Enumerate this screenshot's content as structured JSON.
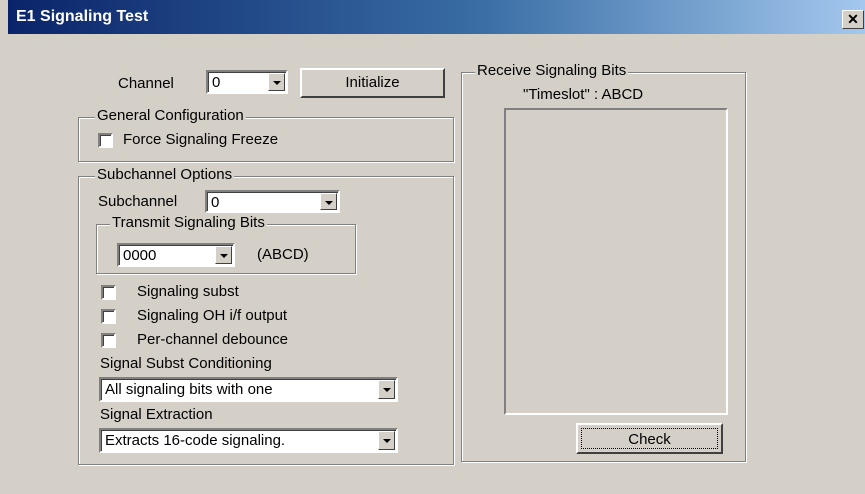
{
  "window": {
    "title": "E1 Signaling Test",
    "close_glyph": "✕"
  },
  "channel": {
    "label": "Channel",
    "value": "0",
    "initialize_label": "Initialize"
  },
  "general": {
    "title": "General Configuration",
    "force_freeze_label": "Force Signaling Freeze"
  },
  "subchannel": {
    "title": "Subchannel Options",
    "subchannel_label": "Subchannel",
    "subchannel_value": "0",
    "transmit_title": "Transmit Signaling Bits",
    "transmit_value": "0000",
    "transmit_suffix": "(ABCD)",
    "checkboxes": [
      "Signaling subst",
      "Signaling OH i/f output",
      "Per-channel debounce"
    ],
    "conditioning_label": "Signal Subst Conditioning",
    "conditioning_value": "All signaling bits with one",
    "extraction_label": "Signal Extraction",
    "extraction_value": "Extracts 16-code signaling."
  },
  "receive": {
    "title": "Receive Signaling Bits",
    "header": "\"Timeslot\" : ABCD",
    "check_label": "Check"
  }
}
